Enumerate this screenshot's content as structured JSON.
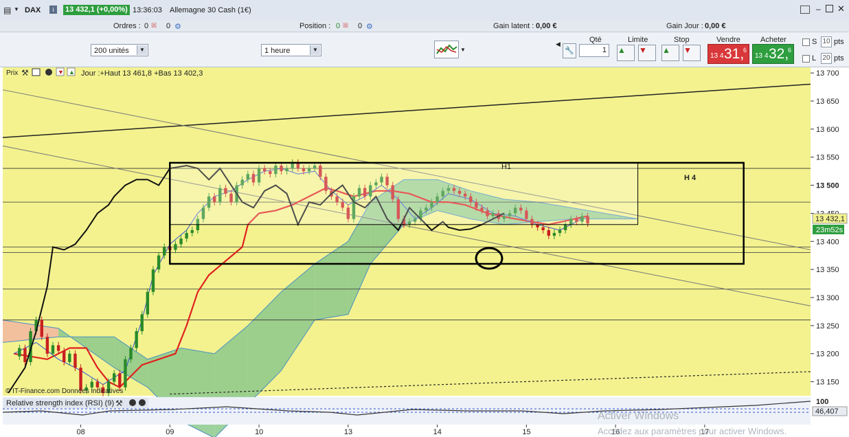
{
  "topbar": {
    "instrument": "DAX",
    "info_icon": "i",
    "price_badge": "13 432,1 (+0,00%)",
    "time": "13:36:03",
    "name": "Allemagne 30 Cash (1€)"
  },
  "status_row": {
    "orders_label": "Ordres :",
    "orders_value": "0",
    "orders_value2": "0",
    "position_label": "Position :",
    "position_value": "0",
    "position_value2": "0",
    "gain_latent_label": "Gain latent :",
    "gain_latent_value": "0,00 €",
    "gain_jour_label": "Gain Jour :",
    "gain_jour_value": "0,00 €"
  },
  "toolbar": {
    "units_select": "200 unités",
    "timeframe_select": "1 heure",
    "qty_label": "Qté",
    "qty_value": "1",
    "limit_label": "Limite",
    "stop_label": "Stop",
    "sell_label": "Vendre",
    "buy_label": "Acheter",
    "sell_prefix": "13 4",
    "sell_big": "31,",
    "sell_sup": "6",
    "buy_prefix": "13 4",
    "buy_big": "32,",
    "buy_sup": "6",
    "s_label": "S",
    "s_value": "10",
    "l_label": "L",
    "l_value": "20",
    "pts_label": "pts"
  },
  "chart_panel": {
    "prix_label": "Prix",
    "jour_label": "Jour :+Haut 13 461,8 +Bas 13 402,3",
    "h1_label": "H1",
    "h4_label": "H 4",
    "copyright": "© IT-Finance.com Données indicatives",
    "price_tag": "13 432,1",
    "timer_tag": "23m52s",
    "rsi_label": "Relative strength index (RSI) (9)",
    "rsi_value_tag": "46,407",
    "rsi_top": "100",
    "watermark1": "Activer Windows",
    "watermark2": "Accédez aux paramètres pour activer Windows."
  },
  "colors": {
    "chart_bg": "#f3f28f",
    "cloud_green": "#8cc98c",
    "cloud_orange": "#f2b7a0",
    "kijun": "#e02020",
    "chikou": "#111111",
    "tenkan": "#3050d0",
    "candle_up": "#2a8a2a",
    "candle_down": "#c82020",
    "sell": "#d9383a",
    "buy": "#2e9e3f"
  },
  "chart_data": {
    "type": "candlestick",
    "instrument": "DAX",
    "ylim": [
      13125,
      13710
    ],
    "y_ticks": [
      13700,
      13650,
      13600,
      13550,
      13500,
      13450,
      13400,
      13350,
      13300,
      13250,
      13200,
      13150
    ],
    "y_tick_labels": [
      "13 700",
      "13 650",
      "13 600",
      "13 550",
      "13 500",
      "13 450",
      "13 400",
      "13 350",
      "13 300",
      "13 250",
      "13 200",
      "13 150"
    ],
    "x_tick_labels": [
      {
        "label": "08",
        "t": 14
      },
      {
        "label": "09",
        "t": 30
      },
      {
        "label": "10",
        "t": 46
      },
      {
        "label": "13",
        "t": 62
      },
      {
        "label": "14",
        "t": 78
      },
      {
        "label": "15",
        "t": 94
      },
      {
        "label": "16",
        "t": 110
      },
      {
        "label": "17",
        "t": 126
      }
    ],
    "xlim": [
      0,
      145
    ],
    "price_path": [
      [
        2,
        13195
      ],
      [
        3,
        13210
      ],
      [
        4,
        13185
      ],
      [
        5,
        13240
      ],
      [
        6,
        13260
      ],
      [
        7,
        13230
      ],
      [
        8,
        13200
      ],
      [
        9,
        13215
      ],
      [
        10,
        13205
      ],
      [
        11,
        13185
      ],
      [
        12,
        13200
      ],
      [
        13,
        13175
      ],
      [
        14,
        13135
      ],
      [
        15,
        13140
      ],
      [
        16,
        13150
      ],
      [
        17,
        13140
      ],
      [
        18,
        13130
      ],
      [
        19,
        13150
      ],
      [
        20,
        13165
      ],
      [
        21,
        13140
      ],
      [
        22,
        13190
      ],
      [
        23,
        13210
      ],
      [
        24,
        13240
      ],
      [
        25,
        13270
      ],
      [
        26,
        13310
      ],
      [
        27,
        13350
      ],
      [
        28,
        13375
      ],
      [
        29,
        13390
      ],
      [
        30,
        13385
      ],
      [
        31,
        13395
      ],
      [
        32,
        13405
      ],
      [
        33,
        13415
      ],
      [
        34,
        13420
      ],
      [
        35,
        13440
      ],
      [
        36,
        13460
      ],
      [
        37,
        13480
      ],
      [
        38,
        13470
      ],
      [
        39,
        13495
      ],
      [
        40,
        13485
      ],
      [
        41,
        13470
      ],
      [
        42,
        13500
      ],
      [
        43,
        13510
      ],
      [
        44,
        13520
      ],
      [
        45,
        13505
      ],
      [
        46,
        13530
      ],
      [
        47,
        13525
      ],
      [
        48,
        13520
      ],
      [
        49,
        13535
      ],
      [
        50,
        13525
      ],
      [
        51,
        13530
      ],
      [
        52,
        13540
      ],
      [
        53,
        13530
      ],
      [
        54,
        13525
      ],
      [
        55,
        13530
      ],
      [
        56,
        13535
      ],
      [
        57,
        13515
      ],
      [
        58,
        13490
      ],
      [
        59,
        13480
      ],
      [
        60,
        13470
      ],
      [
        61,
        13460
      ],
      [
        62,
        13440
      ],
      [
        63,
        13480
      ],
      [
        64,
        13495
      ],
      [
        65,
        13480
      ],
      [
        66,
        13500
      ],
      [
        67,
        13505
      ],
      [
        68,
        13515
      ],
      [
        69,
        13500
      ],
      [
        70,
        13475
      ],
      [
        71,
        13440
      ],
      [
        72,
        13430
      ],
      [
        73,
        13435
      ],
      [
        74,
        13440
      ],
      [
        75,
        13455
      ],
      [
        76,
        13460
      ],
      [
        77,
        13470
      ],
      [
        78,
        13480
      ],
      [
        79,
        13490
      ],
      [
        80,
        13495
      ],
      [
        81,
        13490
      ],
      [
        82,
        13485
      ],
      [
        83,
        13480
      ],
      [
        84,
        13470
      ],
      [
        85,
        13460
      ],
      [
        86,
        13455
      ],
      [
        87,
        13445
      ],
      [
        88,
        13450
      ],
      [
        89,
        13440
      ],
      [
        90,
        13445
      ],
      [
        91,
        13450
      ],
      [
        92,
        13460
      ],
      [
        93,
        13455
      ],
      [
        94,
        13440
      ],
      [
        95,
        13430
      ],
      [
        96,
        13425
      ],
      [
        97,
        13420
      ],
      [
        98,
        13410
      ],
      [
        99,
        13415
      ],
      [
        100,
        13420
      ],
      [
        101,
        13430
      ],
      [
        102,
        13440
      ],
      [
        103,
        13435
      ],
      [
        104,
        13445
      ],
      [
        105,
        13432
      ]
    ],
    "kijun": [
      [
        2,
        13200
      ],
      [
        8,
        13190
      ],
      [
        12,
        13210
      ],
      [
        15,
        13210
      ],
      [
        17,
        13175
      ],
      [
        19,
        13150
      ],
      [
        21,
        13140
      ],
      [
        25,
        13180
      ],
      [
        28,
        13190
      ],
      [
        31,
        13200
      ],
      [
        33,
        13250
      ],
      [
        35,
        13310
      ],
      [
        37,
        13340
      ],
      [
        40,
        13365
      ],
      [
        43,
        13390
      ],
      [
        44,
        13430
      ],
      [
        46,
        13450
      ],
      [
        49,
        13455
      ],
      [
        52,
        13465
      ],
      [
        55,
        13480
      ],
      [
        58,
        13495
      ],
      [
        60,
        13490
      ],
      [
        63,
        13480
      ],
      [
        67,
        13490
      ],
      [
        70,
        13490
      ],
      [
        73,
        13485
      ],
      [
        77,
        13470
      ],
      [
        80,
        13470
      ],
      [
        83,
        13465
      ],
      [
        87,
        13450
      ],
      [
        92,
        13440
      ],
      [
        98,
        13430
      ],
      [
        105,
        13445
      ]
    ],
    "tenkan": [
      [
        2,
        13200
      ],
      [
        6,
        13220
      ],
      [
        10,
        13190
      ],
      [
        14,
        13170
      ],
      [
        18,
        13145
      ],
      [
        22,
        13170
      ],
      [
        25,
        13260
      ],
      [
        27,
        13340
      ],
      [
        30,
        13395
      ],
      [
        33,
        13420
      ],
      [
        35,
        13450
      ],
      [
        38,
        13480
      ],
      [
        41,
        13490
      ],
      [
        44,
        13510
      ],
      [
        47,
        13525
      ],
      [
        50,
        13530
      ],
      [
        53,
        13520
      ],
      [
        56,
        13525
      ],
      [
        59,
        13490
      ],
      [
        62,
        13465
      ],
      [
        65,
        13480
      ],
      [
        68,
        13500
      ],
      [
        71,
        13475
      ],
      [
        74,
        13440
      ],
      [
        77,
        13460
      ],
      [
        80,
        13485
      ],
      [
        84,
        13475
      ],
      [
        88,
        13450
      ],
      [
        92,
        13445
      ],
      [
        96,
        13430
      ],
      [
        100,
        13420
      ],
      [
        104,
        13440
      ]
    ],
    "chikou": [
      [
        1,
        13130
      ],
      [
        4,
        13175
      ],
      [
        6,
        13240
      ],
      [
        8,
        13320
      ],
      [
        9,
        13390
      ],
      [
        11,
        13385
      ],
      [
        13,
        13395
      ],
      [
        15,
        13420
      ],
      [
        17,
        13450
      ],
      [
        19,
        13465
      ],
      [
        20,
        13480
      ],
      [
        22,
        13500
      ],
      [
        24,
        13510
      ],
      [
        26,
        13510
      ],
      [
        28,
        13500
      ],
      [
        30,
        13530
      ],
      [
        33,
        13535
      ],
      [
        35,
        13530
      ],
      [
        37,
        13510
      ],
      [
        39,
        13530
      ],
      [
        41,
        13500
      ],
      [
        43,
        13470
      ],
      [
        45,
        13460
      ],
      [
        47,
        13490
      ],
      [
        49,
        13500
      ],
      [
        51,
        13485
      ],
      [
        53,
        13430
      ],
      [
        55,
        13470
      ],
      [
        57,
        13465
      ],
      [
        59,
        13485
      ],
      [
        61,
        13500
      ],
      [
        63,
        13470
      ],
      [
        65,
        13460
      ],
      [
        67,
        13480
      ],
      [
        69,
        13440
      ],
      [
        71,
        13420
      ],
      [
        73,
        13460
      ],
      [
        75,
        13440
      ],
      [
        77,
        13420
      ],
      [
        79,
        13435
      ],
      [
        80,
        13425
      ],
      [
        82,
        13420
      ],
      [
        84,
        13422
      ],
      [
        86,
        13430
      ],
      [
        88,
        13440
      ],
      [
        90,
        13450
      ]
    ],
    "ssa": [
      [
        0,
        13220
      ],
      [
        10,
        13230
      ],
      [
        20,
        13230
      ],
      [
        26,
        13190
      ],
      [
        32,
        13210
      ],
      [
        38,
        13200
      ],
      [
        44,
        13250
      ],
      [
        50,
        13310
      ],
      [
        56,
        13360
      ],
      [
        62,
        13400
      ],
      [
        66,
        13470
      ],
      [
        72,
        13510
      ],
      [
        78,
        13510
      ],
      [
        84,
        13490
      ],
      [
        90,
        13475
      ],
      [
        96,
        13470
      ],
      [
        102,
        13460
      ],
      [
        108,
        13450
      ],
      [
        114,
        13440
      ]
    ],
    "ssb": [
      [
        0,
        13260
      ],
      [
        10,
        13245
      ],
      [
        20,
        13175
      ],
      [
        26,
        13140
      ],
      [
        32,
        13080
      ],
      [
        38,
        13050
      ],
      [
        44,
        13110
      ],
      [
        50,
        13170
      ],
      [
        56,
        13260
      ],
      [
        62,
        13270
      ],
      [
        66,
        13360
      ],
      [
        72,
        13430
      ],
      [
        78,
        13455
      ],
      [
        84,
        13440
      ],
      [
        90,
        13430
      ],
      [
        96,
        13435
      ],
      [
        102,
        13440
      ],
      [
        108,
        13440
      ],
      [
        114,
        13440
      ]
    ],
    "horizontal_lines": [
      13530,
      13470,
      13390,
      13380,
      13315,
      13260
    ],
    "boxes": [
      {
        "label": "H1",
        "from_t": 30,
        "to_t": 114,
        "low": 13430,
        "high": 13540
      },
      {
        "label": "H 4",
        "from_t": 30,
        "to_t": 133,
        "low": 13360,
        "high": 13540
      }
    ],
    "rsi": {
      "name": "Relative strength index (RSI) (9)",
      "last": 46.407,
      "top": 100
    }
  }
}
